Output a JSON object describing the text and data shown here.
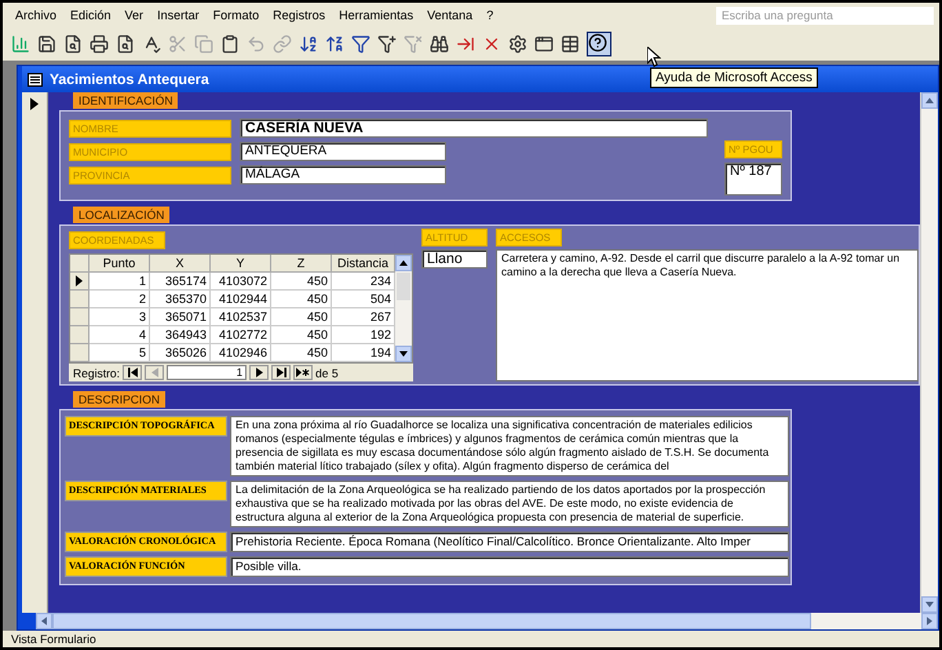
{
  "menu": [
    "Archivo",
    "Edición",
    "Ver",
    "Insertar",
    "Formato",
    "Registros",
    "Herramientas",
    "Ventana",
    "?"
  ],
  "search": {
    "placeholder": "Escriba una pregunta"
  },
  "tooltip": "Ayuda de Microsoft Access",
  "window": {
    "title": "Yacimientos Antequera"
  },
  "identificacion": {
    "title": "IDENTIFICACIÓN",
    "fields": [
      {
        "label": "NOMBRE",
        "value": "CASERÍA NUEVA",
        "kind": "wide"
      },
      {
        "label": "MUNICIPIO",
        "value": "ANTEQUERA",
        "kind": "short"
      },
      {
        "label": "PROVINCIA",
        "value": "MÁLAGA",
        "kind": "short"
      }
    ],
    "pgou": {
      "label": "Nº PGOU",
      "value": "Nº 187"
    }
  },
  "localizacion": {
    "title": "LOCALIZACIÓN",
    "coordenadas": {
      "label": "COORDENADAS",
      "columns": [
        "Punto",
        "X",
        "Y",
        "Z",
        "Distancia"
      ],
      "rows": [
        {
          "cells": [
            "1",
            "365174",
            "4103072",
            "450",
            "234"
          ],
          "selected": true
        },
        {
          "cells": [
            "2",
            "365370",
            "4102944",
            "450",
            "504"
          ],
          "selected": false
        },
        {
          "cells": [
            "3",
            "365071",
            "4102537",
            "450",
            "267"
          ],
          "selected": false
        },
        {
          "cells": [
            "4",
            "364943",
            "4102772",
            "450",
            "192"
          ],
          "selected": false
        },
        {
          "cells": [
            "5",
            "365026",
            "4102946",
            "450",
            "194"
          ],
          "selected": false
        }
      ],
      "navigation": {
        "label": "Registro:",
        "current": "1",
        "total": "de 5"
      }
    },
    "altitud": {
      "label": "ALTITUD",
      "value": "Llano"
    },
    "accesos": {
      "label": "ACCESOS",
      "value": "Carretera y camino,  A-92. Desde el carril que discurre paralelo a la A-92 tomar un camino a la derecha que lleva a Casería Nueva."
    }
  },
  "descripcion": {
    "title": "DESCRIPCION",
    "rows": [
      {
        "label": "DESCRIPCIÓN TOPOGRÁFICA",
        "kind": "memo",
        "value": "En una zona próxima al río Guadalhorce se localiza una significativa concentración de materiales edilicios romanos (especialmente tégulas e ímbrices) y algunos fragmentos de cerámica común mientras que la presencia de sigillata es muy escasa documentándose sólo algún fragmento aislado de T.S.H. Se documenta también material lítico trabajado (sílex y ofita). Algún fragmento disperso de cerámica del"
      },
      {
        "label": "DESCRIPCIÓN MATERIALES",
        "kind": "memo",
        "value": "La delimitación de la Zona Arqueológica se ha realizado partiendo de los datos aportados por la prospección exhaustiva que se ha realizado motivada por las obras del AVE. De este modo, no existe evidencia de estructura alguna al exterior de la Zona Arqueológica propuesta con presencia de material de superficie."
      },
      {
        "label": "VALORACIÓN CRONOLÓGICA",
        "kind": "line",
        "value": "Prehistoria Reciente. Época Romana (Neolítico Final/Calcolítico. Bronce Orientalizante. Alto Imper"
      },
      {
        "label": "VALORACIÓN FUNCIÓN",
        "kind": "line",
        "value": "Posible villa."
      }
    ]
  },
  "status_bar": "Vista Formulario"
}
